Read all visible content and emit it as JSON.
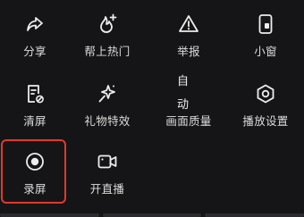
{
  "menu": {
    "items": [
      {
        "key": "share",
        "label": "分享",
        "icon": "share-icon"
      },
      {
        "key": "trending",
        "label": "帮上热门",
        "icon": "flame-plus-icon"
      },
      {
        "key": "report",
        "label": "举报",
        "icon": "warning-icon"
      },
      {
        "key": "small_window",
        "label": "小窗",
        "icon": "phone-window-icon"
      },
      {
        "key": "clear_screen",
        "label": "清屏",
        "icon": "clear-screen-icon"
      },
      {
        "key": "gift_effects",
        "label": "礼物特效",
        "icon": "sparkle-icon"
      },
      {
        "key": "quality",
        "label": "画面质量",
        "icon_text": "自动"
      },
      {
        "key": "settings",
        "label": "播放设置",
        "icon": "hexagon-gear-icon"
      },
      {
        "key": "record",
        "label": "录屏",
        "icon": "record-icon",
        "highlighted": true
      },
      {
        "key": "go_live",
        "label": "开直播",
        "icon": "camera-icon"
      }
    ]
  },
  "colors": {
    "background": "#151517",
    "icon": "#ededed",
    "label": "#dcdcdc",
    "highlight_border": "#e0392b"
  }
}
